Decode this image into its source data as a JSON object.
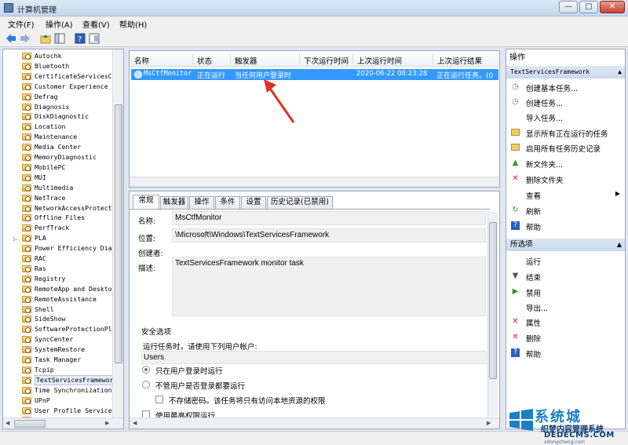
{
  "window": {
    "title": "计算机管理",
    "min": "—",
    "max": "□",
    "close": "✕"
  },
  "menu": [
    "文件(F)",
    "操作(A)",
    "查看(V)",
    "帮助(H)"
  ],
  "tree": {
    "items": [
      "Autochk",
      "Bluetooth",
      "CertificateServicesC",
      "Customer Experience I",
      "Defrag",
      "Diagnosis",
      "DiskDiagnostic",
      "Location",
      "Maintenance",
      "Media Center",
      "MemoryDiagnostic",
      "MobilePC",
      "MUI",
      "Multimedia",
      "NetTrace",
      "NetworkAccessProtect",
      "Offline Files",
      "PerfTrack",
      "PLA",
      "Power Efficiency Dia",
      "RAC",
      "Ras",
      "Registry",
      "RemoteApp and Desktop",
      "RemoteAssistance",
      "Shell",
      "SideShow",
      "SoftwareProtectionPl",
      "SyncCenter",
      "SystemRestore",
      "Task Manager",
      "Tcpip",
      "TextServicesFramework",
      "Time Synchronization",
      "UPnP",
      "User Profile Service",
      "WDI"
    ],
    "selected_index": 32,
    "expandable_index": 18
  },
  "tasklist": {
    "columns": [
      "名称",
      "状态",
      "触发器",
      "下次运行时间",
      "上次运行时间",
      "上次运行结果"
    ],
    "row": {
      "name": "MsCtfMonitor",
      "status": "正在运行",
      "trigger": "当任何用户登录时",
      "next": "",
      "last": "2020-06-22 08:23:28",
      "result": "正在运行任务。(0"
    }
  },
  "details": {
    "tabs": [
      "常规",
      "触发器",
      "操作",
      "条件",
      "设置",
      "历史记录(已禁用)"
    ],
    "name_label": "名称:",
    "name_value": "MsCtfMonitor",
    "location_label": "位置:",
    "location_value": "\\Microsoft\\Windows\\TextServicesFramework",
    "author_label": "创建者:",
    "desc_label": "描述:",
    "desc_value": "TextServicesFramework monitor task",
    "security_title": "安全选项",
    "run_as_label": "运行任务时，请使用下列用户帐户:",
    "user_value": "Users",
    "opt1": "只在用户登录时运行",
    "opt2": "不管用户是否登录都要运行",
    "opt3": "不存储密码。该任务将只有访问本地资源的权限",
    "opt4": "使用最高权限运行"
  },
  "actions": {
    "header": "操作",
    "section1": "TextServicesFramework",
    "items1": [
      "创建基本任务...",
      "创建任务...",
      "导入任务...",
      "显示所有正在运行的任务",
      "启用所有任务历史记录",
      "新文件夹...",
      "删除文件夹",
      "查看",
      "刷新",
      "帮助"
    ],
    "section2": "所选项",
    "items2": [
      "运行",
      "结束",
      "禁用",
      "导出...",
      "属性",
      "删除",
      "帮助"
    ]
  },
  "watermark": {
    "big": "系统城",
    "line1": "织梦内容管理系统",
    "line2": "DEDECMS.COM",
    "line3": "xitongcheng.com"
  },
  "colors": {
    "selection": "#3399ff",
    "accent_red": "#e03020",
    "watermark_blue": "#1b7fc4"
  }
}
